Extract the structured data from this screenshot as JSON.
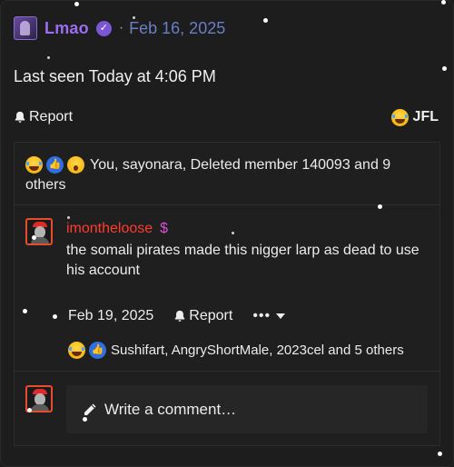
{
  "post": {
    "username": "Lmao",
    "separator": "·",
    "date": "Feb 16, 2025",
    "last_seen": "Last seen Today at 4:06 PM",
    "report_label": "Report",
    "reaction_label": "JFL"
  },
  "reactions_summary": {
    "text": "You, sayonara, Deleted member 140093 and 9 others"
  },
  "comment": {
    "username": "imontheloose",
    "badge": "$",
    "text": "the somali pirates made this nigger larp as dead to use his account",
    "date": "Feb 19, 2025",
    "report_label": "Report",
    "more_label": "•••",
    "reactions_text": "Sushifart, AngryShortMale, 2023cel and 5 others"
  },
  "compose": {
    "placeholder": "Write a comment…"
  },
  "icons": [
    "verified-icon",
    "bell-icon",
    "laugh-cry-emoji-icon",
    "like-icon",
    "wow-emoji-icon",
    "pencil-icon",
    "caret-down-icon"
  ],
  "colors": {
    "background": "#1b1b1b",
    "username": "#9b6df0",
    "date_link": "#6a7fc4",
    "comment_user": "#ff3b30",
    "avatar_border": "#e84d2b"
  }
}
